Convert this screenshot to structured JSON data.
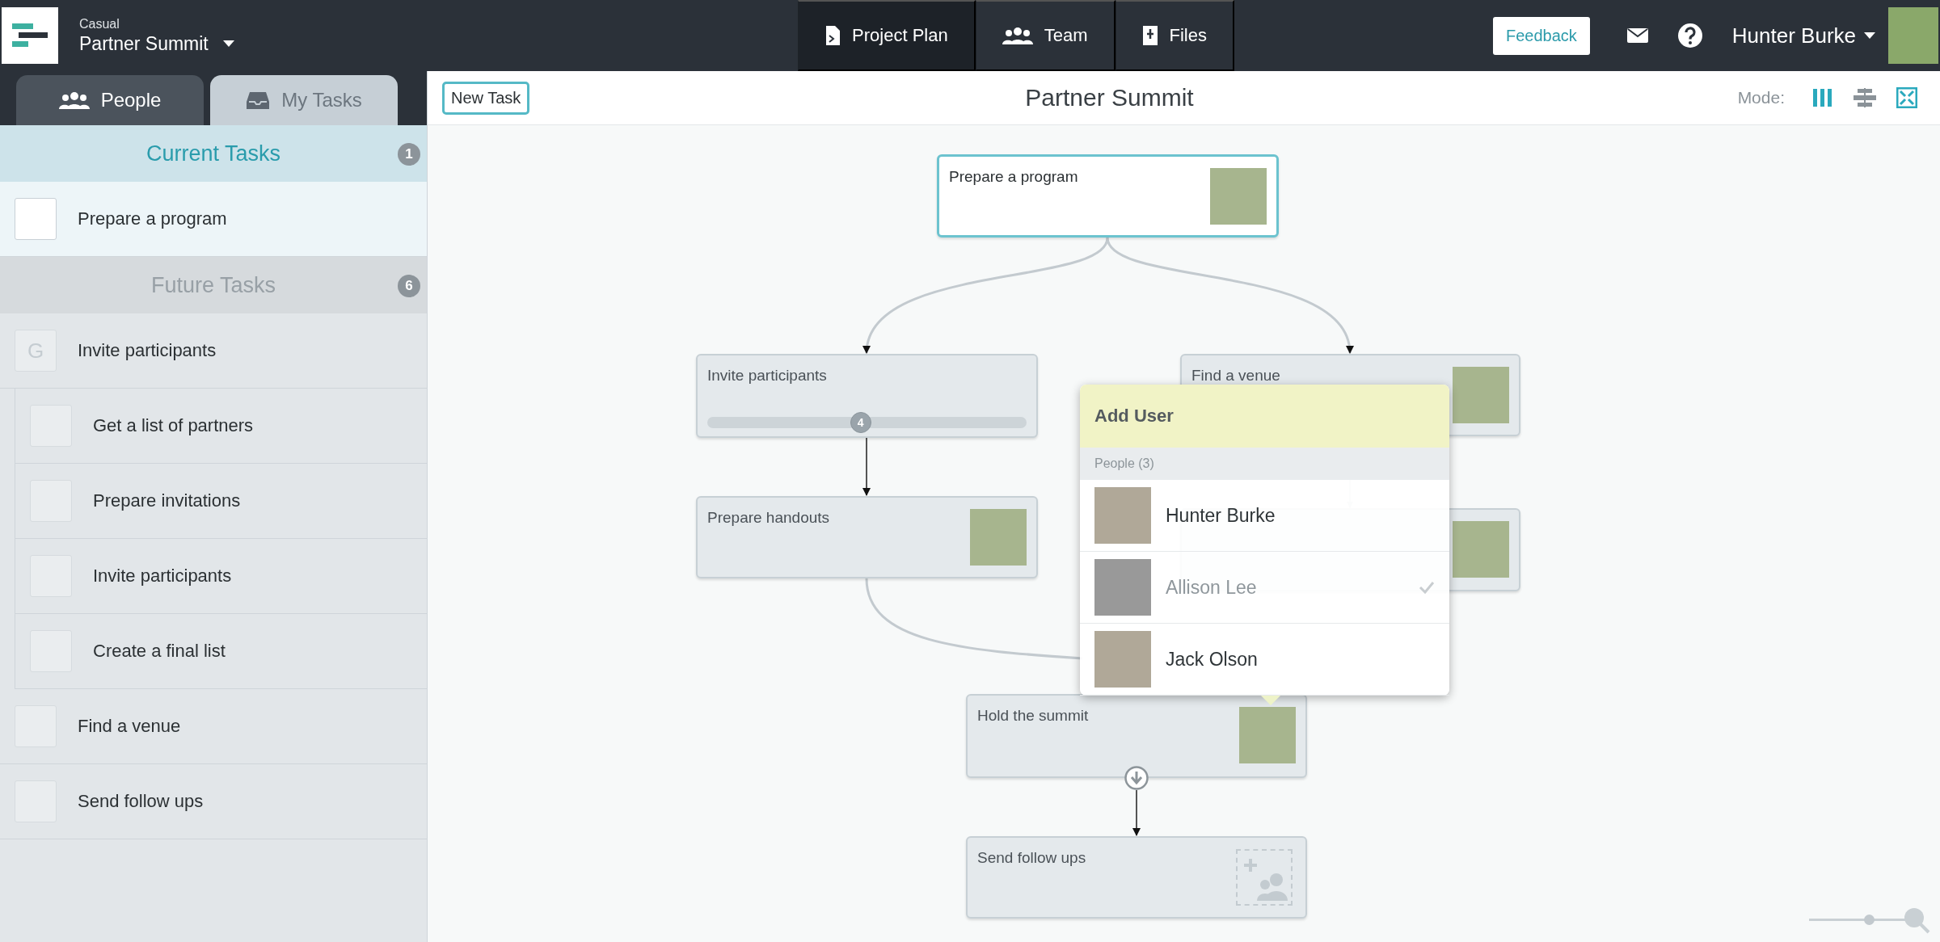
{
  "topbar": {
    "workspace": "Casual",
    "project": "Partner Summit",
    "nav": [
      {
        "label": "Project Plan",
        "selected": true
      },
      {
        "label": "Team",
        "selected": false
      },
      {
        "label": "Files",
        "selected": false
      }
    ],
    "feedback": "Feedback",
    "user": "Hunter Burke"
  },
  "sidebar": {
    "tabs": [
      {
        "label": "People",
        "selected": false
      },
      {
        "label": "My Tasks",
        "selected": true
      }
    ],
    "sections": [
      {
        "title": "Current Tasks",
        "count": "1",
        "active": true,
        "items": [
          {
            "label": "Prepare a program",
            "selected": true
          }
        ]
      },
      {
        "title": "Future Tasks",
        "count": "6",
        "active": false,
        "items": [
          {
            "label": "Invite participants",
            "selected": false,
            "mark": "G",
            "children": [
              {
                "label": "Get a list of partners",
                "selected": false
              },
              {
                "label": "Prepare invitations",
                "selected": false
              },
              {
                "label": "Invite participants",
                "selected": false
              },
              {
                "label": "Create a final list",
                "selected": false
              }
            ]
          },
          {
            "label": "Find a venue",
            "selected": false
          },
          {
            "label": "Send follow ups",
            "selected": false
          }
        ]
      }
    ]
  },
  "canvas": {
    "new_task": "New Task",
    "title": "Partner Summit",
    "mode_label": "Mode:",
    "modes": [
      {
        "selected": true
      },
      {
        "selected": false
      }
    ],
    "nodes": [
      {
        "title": "Prepare a program",
        "selected": true,
        "kind": "assigned"
      },
      {
        "title": "Invite participants",
        "selected": false,
        "kind": "group",
        "progress": {
          "level": 0.48,
          "reading": "4"
        }
      },
      {
        "title": "Find a venue",
        "selected": false,
        "kind": "assigned"
      },
      {
        "title": "Prepare handouts",
        "selected": false,
        "kind": "assigned"
      },
      {
        "selected": false,
        "kind": "assigned"
      },
      {
        "title": "Hold the summit",
        "selected": false,
        "kind": "assigned"
      },
      {
        "title": "Send follow ups",
        "selected": false,
        "kind": "unassigned"
      }
    ],
    "popup": {
      "title": "Add User",
      "group": "People (3)",
      "people": [
        {
          "name": "Hunter Burke",
          "checked": false
        },
        {
          "name": "Allison Lee",
          "checked": true
        },
        {
          "name": "Jack Olson",
          "checked": false
        }
      ]
    },
    "zoom": {
      "level": 0.62
    }
  }
}
